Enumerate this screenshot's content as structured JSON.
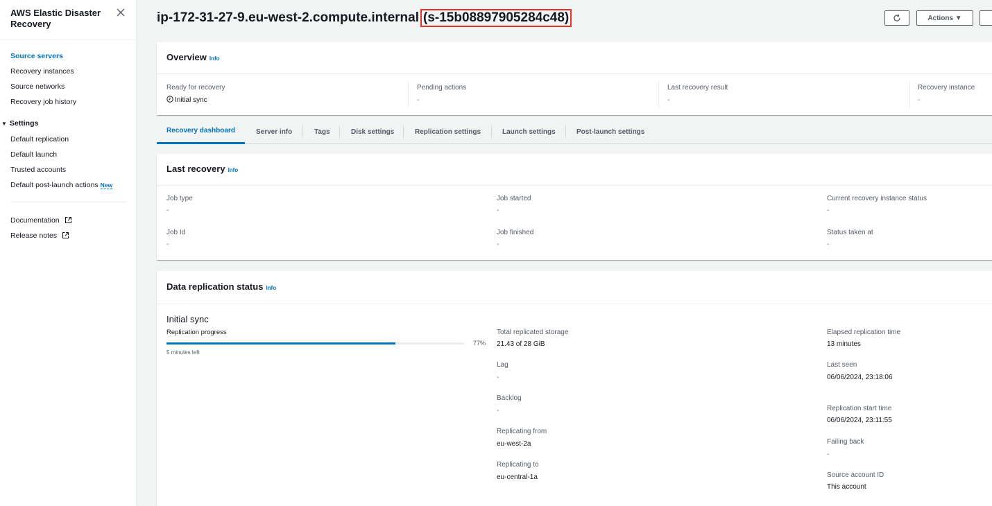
{
  "sidebar": {
    "title": "AWS Elastic Disaster Recovery",
    "items": [
      {
        "label": "Source servers"
      },
      {
        "label": "Recovery instances"
      },
      {
        "label": "Source networks"
      },
      {
        "label": "Recovery job history"
      }
    ],
    "settings": {
      "label": "Settings",
      "items": [
        {
          "label": "Default replication"
        },
        {
          "label": "Default launch"
        },
        {
          "label": "Trusted accounts"
        },
        {
          "label": "Default post-launch actions",
          "badge": "New"
        }
      ]
    },
    "links": [
      {
        "label": "Documentation"
      },
      {
        "label": "Release notes"
      }
    ]
  },
  "header": {
    "hostname": "ip-172-31-27-9.eu-west-2.compute.internal",
    "server_id": "(s-15b08897905284c48)",
    "actions_label": "Actions ▼"
  },
  "overview": {
    "title": "Overview",
    "info": "Info",
    "fields": [
      {
        "label": "Ready for recovery",
        "value": "Initial sync"
      },
      {
        "label": "Pending actions",
        "value": "-"
      },
      {
        "label": "Last recovery result",
        "value": "-"
      },
      {
        "label": "Recovery instance",
        "value": "-"
      }
    ]
  },
  "tabs": [
    {
      "label": "Recovery dashboard"
    },
    {
      "label": "Server info"
    },
    {
      "label": "Tags"
    },
    {
      "label": "Disk settings"
    },
    {
      "label": "Replication settings"
    },
    {
      "label": "Launch settings"
    },
    {
      "label": "Post-launch settings"
    }
  ],
  "last_recovery": {
    "title": "Last recovery",
    "info": "Info",
    "fields": [
      {
        "label": "Job type",
        "value": "-"
      },
      {
        "label": "Job started",
        "value": "-"
      },
      {
        "label": "Current recovery instance status",
        "value": "-"
      },
      {
        "label": "Job Id",
        "value": "-"
      },
      {
        "label": "Job finished",
        "value": "-"
      },
      {
        "label": "Status taken at",
        "value": "-"
      }
    ]
  },
  "data_replication": {
    "title": "Data replication status",
    "info": "Info",
    "state": "Initial sync",
    "progress_label": "Replication progress",
    "progress_percent": 77,
    "progress_text": "77%",
    "time_left": "5 minutes left",
    "middle": [
      {
        "label": "Total replicated storage",
        "value": "21.43 of 28 GiB"
      },
      {
        "label": "Lag",
        "value": "-"
      },
      {
        "label": "Backlog",
        "value": "-"
      },
      {
        "label": "Replicating from",
        "value": "eu-west-2a"
      },
      {
        "label": "Replicating to",
        "value": "eu-central-1a"
      }
    ],
    "right": [
      {
        "label": "Elapsed replication time",
        "value": "13 minutes"
      },
      {
        "label": "Last seen",
        "value": "06/06/2024, 23:18:06"
      },
      {
        "label": "Replication start time",
        "value": "06/06/2024, 23:11:55"
      },
      {
        "label": "Failing back",
        "value": "-"
      },
      {
        "label": "Source account ID",
        "value": "This account"
      }
    ]
  }
}
